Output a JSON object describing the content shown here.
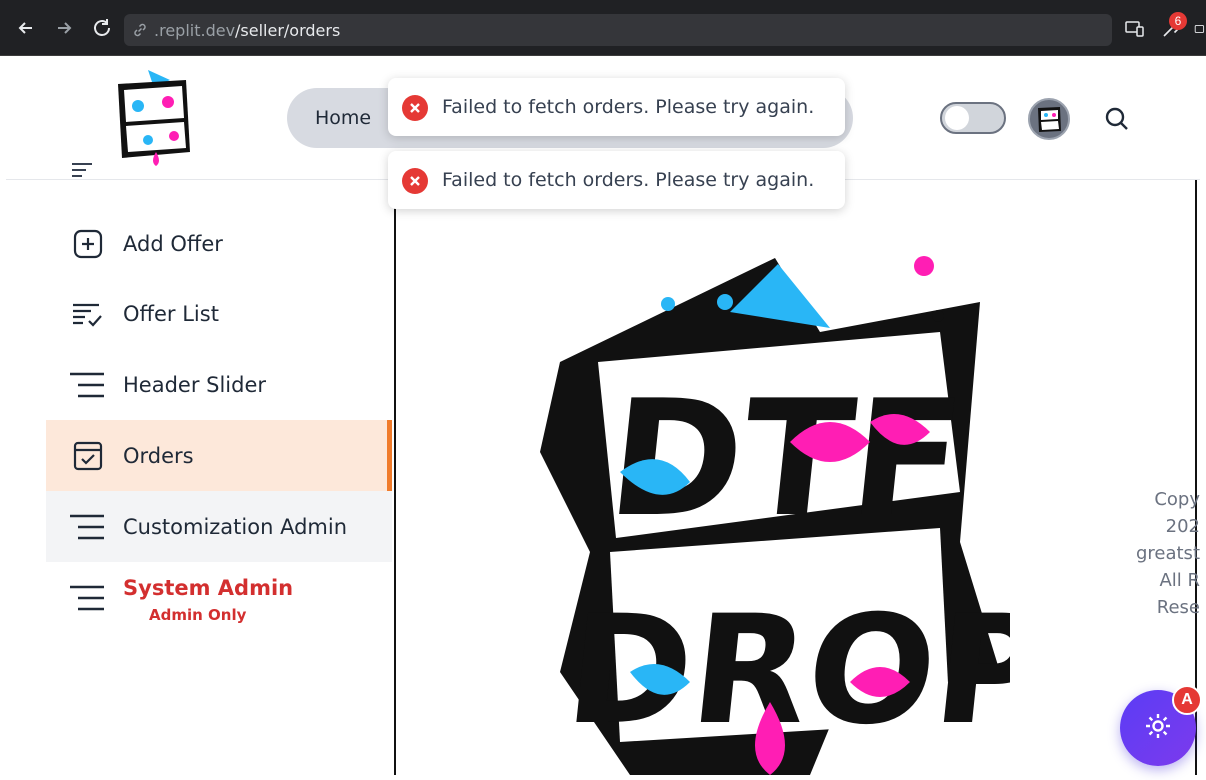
{
  "browser": {
    "url_dim": ".replit.dev",
    "url_path": "/seller/orders",
    "extension_badge": "6"
  },
  "header": {
    "nav_home": "Home"
  },
  "toasts": [
    {
      "message": "Failed to fetch orders. Please try again."
    },
    {
      "message": "Failed to fetch orders. Please try again."
    }
  ],
  "sidebar": {
    "items": [
      {
        "label": "Add Offer",
        "icon": "add-square-icon"
      },
      {
        "label": "Offer List",
        "icon": "checklist-icon"
      },
      {
        "label": "Header Slider",
        "icon": "menu-lines-icon"
      },
      {
        "label": "Orders",
        "icon": "calendar-check-icon",
        "active": true
      },
      {
        "label": "Customization Admin",
        "icon": "menu-lines-icon"
      },
      {
        "label": "System Admin",
        "sub": "Admin Only",
        "icon": "menu-lines-icon"
      }
    ]
  },
  "footer": {
    "lines": [
      "Copy",
      "202",
      "greatst",
      "All R",
      "Rese"
    ]
  },
  "fab": {
    "badge": "A"
  },
  "colors": {
    "active_bg": "#fde8da",
    "active_bar": "#f07b2b",
    "admin_red": "#d32f2f",
    "toast_error": "#e53935",
    "fab": "#6a3cf0"
  }
}
